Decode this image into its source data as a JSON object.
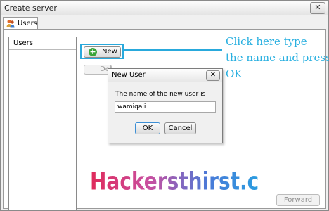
{
  "window": {
    "title": "Create server",
    "close_glyph": "✕"
  },
  "tabs": [
    {
      "label": "Users",
      "icon": "users-icon"
    }
  ],
  "users_list": {
    "header": "Users"
  },
  "buttons": {
    "new": "New",
    "new_icon": "plus-circle-icon",
    "delete": "Delete",
    "forward": "Forward"
  },
  "annotation": {
    "lines": [
      "Click here type",
      "the name and press",
      "OK"
    ],
    "color": "#2ab0e0"
  },
  "dialog": {
    "title": "New User",
    "prompt": "The name of the new user is",
    "value": "wamiqali",
    "ok": "OK",
    "cancel": "Cancel",
    "close_glyph": "✕"
  },
  "watermark": {
    "text": "Hackersthirst.com"
  },
  "colors": {
    "accent": "#29a9dc",
    "add_icon": "#3aa43a"
  }
}
